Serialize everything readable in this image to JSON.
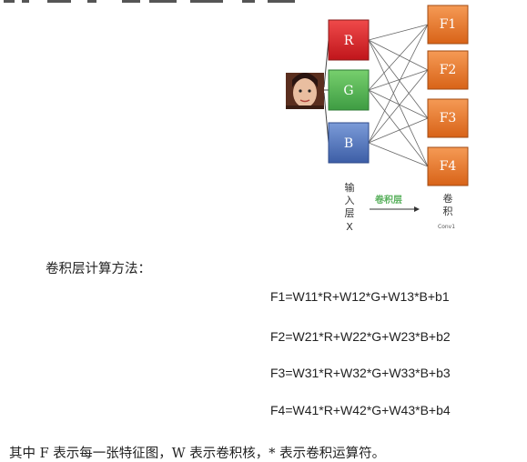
{
  "diagram": {
    "input_channels": [
      "R",
      "G",
      "B"
    ],
    "feature_maps": [
      "F1",
      "F2",
      "F3",
      "F4"
    ],
    "input_caption_chars": [
      "输",
      "入",
      "层",
      "X"
    ],
    "arrow_label": "卷积层",
    "output_caption_chars": [
      "卷",
      "积"
    ],
    "output_sub": "Conv1",
    "colors": {
      "R": "#d8262c",
      "G": "#56b85a",
      "B": "#4d6fb6",
      "F": "#e8782c"
    },
    "photo_icon": "face-photo-icon"
  },
  "section_heading": "卷积层计算方法：",
  "formulas": [
    "F1=W11*R+W12*G+W13*B+b1",
    "F2=W21*R+W22*G+W23*B+b2",
    "F3=W31*R+W32*G+W33*B+b3",
    "F4=W41*R+W42*G+W43*B+b4"
  ],
  "footnote": "其中 F 表示每一张特征图，W 表示卷积核，* 表示卷积运算符。"
}
